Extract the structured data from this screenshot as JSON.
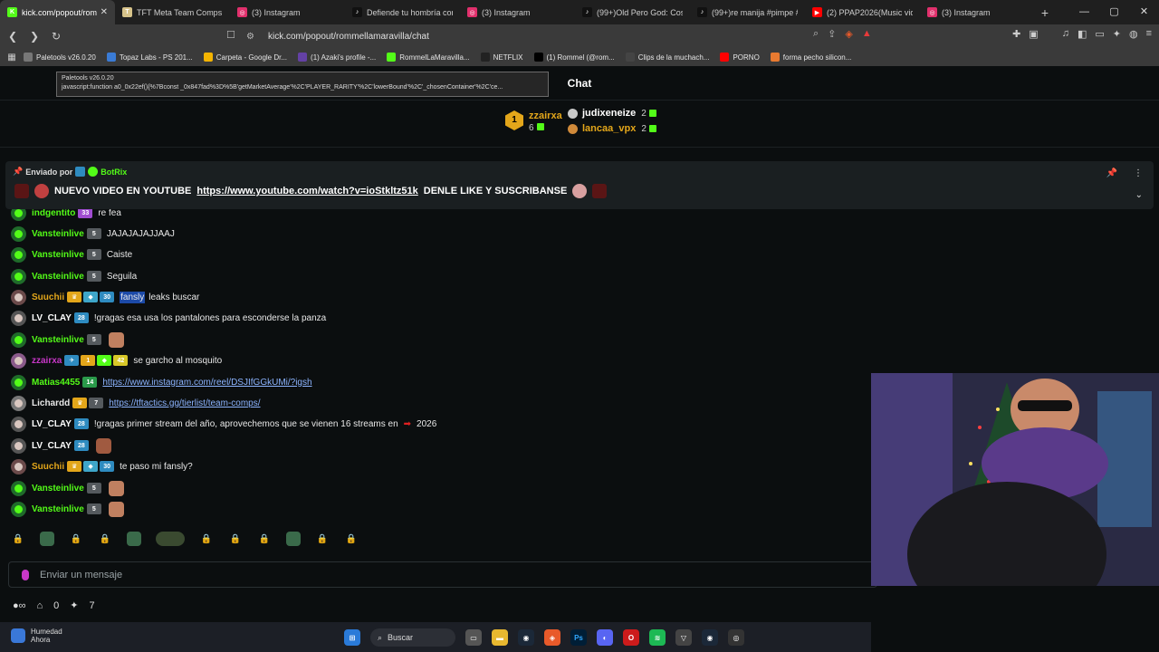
{
  "browser": {
    "tabs": [
      {
        "title": "kick.com/popout/rom",
        "fav_color": "#53fc18",
        "fav_glyph": "K",
        "active": true
      },
      {
        "title": "TFT Meta Team Comps Tie",
        "fav_color": "#d7c38a",
        "fav_glyph": "T",
        "active": false
      },
      {
        "title": "(3) Instagram",
        "fav_color": "#e1306c",
        "fav_glyph": "◎",
        "active": false
      },
      {
        "title": "Defiende tu hombría con",
        "fav_color": "#111111",
        "fav_glyph": "♪",
        "active": false
      },
      {
        "title": "(3) Instagram",
        "fav_color": "#e1306c",
        "fav_glyph": "◎",
        "active": false
      },
      {
        "title": "(99+)Old Pero God: Coscu",
        "fav_color": "#111111",
        "fav_glyph": "♪",
        "active": false
      },
      {
        "title": "(99+)re manija #pimpe #",
        "fav_color": "#111111",
        "fav_glyph": "♪",
        "active": false
      },
      {
        "title": "(2) PPAP2026(Music video",
        "fav_color": "#ff0000",
        "fav_glyph": "▶",
        "active": false
      },
      {
        "title": "(3) Instagram",
        "fav_color": "#e1306c",
        "fav_glyph": "◎",
        "active": false
      }
    ],
    "url": "kick.com/popout/rommellamaravilla/chat",
    "bookmarks": [
      {
        "label": "Paletools v26.0.20",
        "color": "#777777"
      },
      {
        "label": "Topaz Labs - PS 201...",
        "color": "#3a7bd5"
      },
      {
        "label": "Carpeta - Google Dr...",
        "color": "#f4b400"
      },
      {
        "label": "(1) Azaki's profile -...",
        "color": "#6441a5"
      },
      {
        "label": "RommelLaMaravilla...",
        "color": "#53fc18"
      },
      {
        "label": "NETFLIX",
        "color": "#222222"
      },
      {
        "label": "(1) Rommel (@rom...",
        "color": "#000000"
      },
      {
        "label": "Clips de la muchach...",
        "color": "#444444"
      },
      {
        "label": "PORNO",
        "color": "#ff0000"
      },
      {
        "label": "forma pecho silicon...",
        "color": "#e87a30"
      }
    ],
    "tooltip": {
      "line1": "Paletools v26.0.20",
      "line2": "javascript:function a0_0x22ef(){%7Bconst _0x847fad%3D%5B'getMarketAverage'%2C'PLAYER_RARITY'%2C'lowerBound'%2C'_chosenContainer'%2C'ce..."
    }
  },
  "chat": {
    "title": "Chat",
    "leaderboard": {
      "first": {
        "rank": "1",
        "name": "zzairxa",
        "count": "6"
      },
      "others": [
        {
          "name": "judixeneize",
          "count": "2",
          "color": "#ffffff",
          "medal": "#c9c9c9"
        },
        {
          "name": "lancaa_vpx",
          "count": "2",
          "color": "#e3a61a",
          "medal": "#d08a3a"
        }
      ]
    },
    "pinned": {
      "sent_by_label": "Enviado por",
      "sent_by_user": "BotRix",
      "message_pre": "NUEVO VIDEO EN YOUTUBE",
      "link": "https://www.youtube.com/watch?v=ioStkltz51k",
      "message_post": "DENLE LIKE Y SUSCRIBANSE"
    },
    "messages": [
      {
        "user": "indgentito",
        "color": "#53fc18",
        "avatar": "#1f6b2a",
        "badges": [
          {
            "t": "33",
            "c": "#a04cd0"
          }
        ],
        "text": "re fea",
        "partial": true
      },
      {
        "user": "Vansteinlive",
        "color": "#53fc18",
        "avatar": "#1f6b2a",
        "badges": [
          {
            "t": "5",
            "c": "#555a5e"
          }
        ],
        "text": "JAJAJAJAJJAAJ"
      },
      {
        "user": "Vansteinlive",
        "color": "#53fc18",
        "avatar": "#1f6b2a",
        "badges": [
          {
            "t": "5",
            "c": "#555a5e"
          }
        ],
        "text": "Caiste"
      },
      {
        "user": "Vansteinlive",
        "color": "#53fc18",
        "avatar": "#1f6b2a",
        "badges": [
          {
            "t": "5",
            "c": "#555a5e"
          }
        ],
        "text": "Seguila"
      },
      {
        "user": "Suuchii",
        "color": "#e3a61a",
        "avatar": "#6b4a4a",
        "badges": [
          {
            "t": "♛",
            "c": "#e3a61a"
          },
          {
            "t": "◆",
            "c": "#3ea6c9"
          },
          {
            "t": "30",
            "c": "#2e8bc0"
          }
        ],
        "text_hl": "fansly",
        "text": "leaks buscar"
      },
      {
        "user": "LV_CLAY",
        "color": "#ffffff",
        "avatar": "#555555",
        "badges": [
          {
            "t": "28",
            "c": "#2e8bc0"
          }
        ],
        "text": "!gragas esa usa los pantalones para esconderse la panza"
      },
      {
        "user": "Vansteinlive",
        "color": "#53fc18",
        "avatar": "#1f6b2a",
        "badges": [
          {
            "t": "5",
            "c": "#555a5e"
          }
        ],
        "emote": "#c08060"
      },
      {
        "user": "zzairxa",
        "color": "#c837c8",
        "avatar": "#8a5a8a",
        "badges": [
          {
            "t": "✈",
            "c": "#2e8bc0"
          },
          {
            "t": "1",
            "c": "#e3a61a"
          },
          {
            "t": "◆",
            "c": "#53fc18"
          },
          {
            "t": "42",
            "c": "#d8c828"
          }
        ],
        "text": "se garcho al mosquito"
      },
      {
        "user": "Matias4455",
        "color": "#53fc18",
        "avatar": "#1f6b2a",
        "badges": [
          {
            "t": "14",
            "c": "#2a9a4a"
          }
        ],
        "link": "https://www.instagram.com/reel/DSJIfGGkUMi/?igsh"
      },
      {
        "user": "Lichardd",
        "color": "#e8e8e8",
        "avatar": "#777777",
        "badges": [
          {
            "t": "♛",
            "c": "#e3a61a"
          },
          {
            "t": "7",
            "c": "#555a5e"
          }
        ],
        "link": "https://tftactics.gg/tierlist/team-comps/"
      },
      {
        "user": "LV_CLAY",
        "color": "#ffffff",
        "avatar": "#555555",
        "badges": [
          {
            "t": "28",
            "c": "#2e8bc0"
          }
        ],
        "text": "!gragas primer stream del año, aprovechemos que se vienen 16 streams en",
        "text_after": "2026"
      },
      {
        "user": "LV_CLAY",
        "color": "#ffffff",
        "avatar": "#555555",
        "badges": [
          {
            "t": "28",
            "c": "#2e8bc0"
          }
        ],
        "emote": "#a05a40"
      },
      {
        "user": "Suuchii",
        "color": "#e3a61a",
        "avatar": "#6b4a4a",
        "badges": [
          {
            "t": "♛",
            "c": "#e3a61a"
          },
          {
            "t": "◆",
            "c": "#3ea6c9"
          },
          {
            "t": "30",
            "c": "#2e8bc0"
          }
        ],
        "text": "te paso mi fansly?"
      },
      {
        "user": "Vansteinlive",
        "color": "#53fc18",
        "avatar": "#1f6b2a",
        "badges": [
          {
            "t": "5",
            "c": "#555a5e"
          }
        ],
        "emote": "#c08060"
      },
      {
        "user": "Vansteinlive",
        "color": "#53fc18",
        "avatar": "#1f6b2a",
        "badges": [
          {
            "t": "5",
            "c": "#555a5e"
          }
        ],
        "emote": "#c08060"
      }
    ],
    "input_placeholder": "Enviar un mensaje",
    "footer": {
      "count_a": "0",
      "count_b": "7"
    }
  },
  "taskbar": {
    "weather_title": "Humedad",
    "weather_sub": "Ahora",
    "search_label": "Buscar"
  }
}
